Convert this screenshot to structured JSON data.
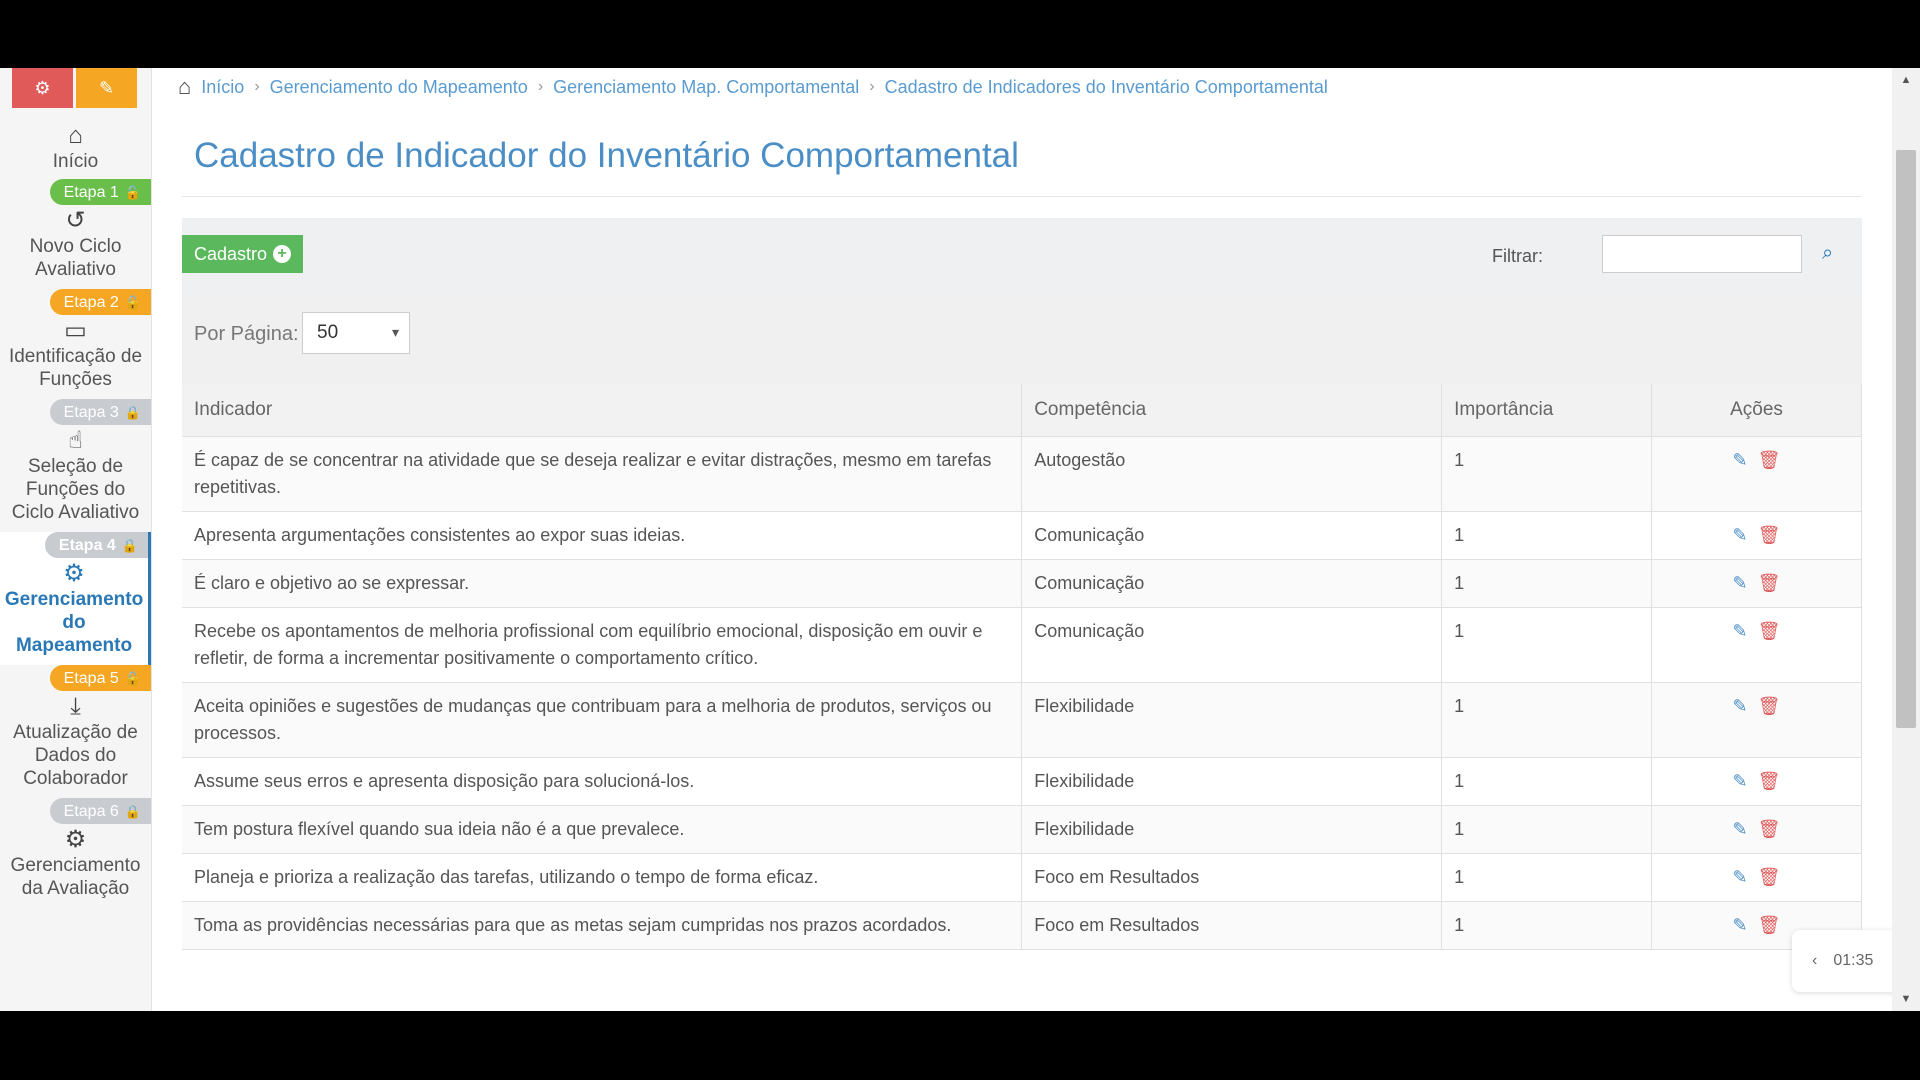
{
  "sidebar": {
    "top_buttons": [
      {
        "icon": "gear-icon",
        "glyph": "⚙",
        "color": "#e05a5a"
      },
      {
        "icon": "edit-icon",
        "glyph": "✎",
        "color": "#f5a623"
      }
    ],
    "home": {
      "label": "Início",
      "icon": "home-icon"
    },
    "items": [
      {
        "stage": "Etapa 1",
        "stage_color": "green",
        "lock": "unlocked",
        "label": "Novo Ciclo Avaliativo",
        "icon": "history-icon"
      },
      {
        "stage": "Etapa 2",
        "stage_color": "orange",
        "lock": "unlocked",
        "label": "Identificação de Funções",
        "icon": "inbox-icon"
      },
      {
        "stage": "Etapa 3",
        "stage_color": "gray",
        "lock": "locked",
        "label": "Seleção de Funções do Ciclo Avaliativo",
        "icon": "pointer-icon"
      },
      {
        "stage": "Etapa 4",
        "stage_color": "gray",
        "lock": "locked",
        "label": "Gerenciamento do Mapeamento",
        "icon": "gears-icon",
        "active": true
      },
      {
        "stage": "Etapa 5",
        "stage_color": "orange",
        "lock": "unlocked",
        "label": "Atualização de Dados do Colaborador",
        "icon": "download-icon"
      },
      {
        "stage": "Etapa 6",
        "stage_color": "gray",
        "lock": "locked",
        "label": "Gerenciamento da Avaliação",
        "icon": "gears-icon"
      }
    ]
  },
  "breadcrumb": {
    "items": [
      "Início",
      "Gerenciamento do Mapeamento",
      "Gerenciamento Map. Comportamental",
      "Cadastro de Indicadores do Inventário Comportamental"
    ]
  },
  "page": {
    "title": "Cadastro de Indicador do Inventário Comportamental",
    "cadastro_label": "Cadastro",
    "filter_label": "Filtrar:",
    "filter_value": "",
    "per_page_label": "Por Página:",
    "per_page_value": "50"
  },
  "table": {
    "headers": [
      "Indicador",
      "Competência",
      "Importância",
      "Ações"
    ],
    "rows": [
      {
        "indicador": "É capaz de se concentrar na atividade que se deseja realizar e evitar distrações, mesmo em tarefas repetitivas.",
        "competencia": "Autogestão",
        "importancia": "1"
      },
      {
        "indicador": "Apresenta argumentações consistentes ao expor suas ideias.",
        "competencia": "Comunicação",
        "importancia": "1"
      },
      {
        "indicador": "É claro e objetivo ao se expressar.",
        "competencia": "Comunicação",
        "importancia": "1"
      },
      {
        "indicador": "Recebe os apontamentos de melhoria profissional com equilíbrio emocional, disposição em ouvir e refletir, de forma a incrementar positivamente o comportamento crítico.",
        "competencia": "Comunicação",
        "importancia": "1"
      },
      {
        "indicador": "Aceita opiniões e sugestões de mudanças que contribuam para a melhoria de produtos, serviços ou processos.",
        "competencia": "Flexibilidade",
        "importancia": "1"
      },
      {
        "indicador": "Assume seus erros e apresenta disposição para solucioná-los.",
        "competencia": "Flexibilidade",
        "importancia": "1"
      },
      {
        "indicador": "Tem postura flexível quando sua ideia não é a que prevalece.",
        "competencia": "Flexibilidade",
        "importancia": "1"
      },
      {
        "indicador": "Planeja e prioriza a realização das tarefas, utilizando o tempo de forma eficaz.",
        "competencia": "Foco em Resultados",
        "importancia": "1"
      },
      {
        "indicador": "Toma as providências necessárias para que as metas sejam cumpridas nos prazos acordados.",
        "competencia": "Foco em Resultados",
        "importancia": "1"
      }
    ]
  },
  "recorder": {
    "time": "01:35"
  },
  "colors": {
    "accent": "#4b8ec6",
    "success": "#5cb85c",
    "danger": "#e05a5a",
    "warning": "#f5a623"
  }
}
